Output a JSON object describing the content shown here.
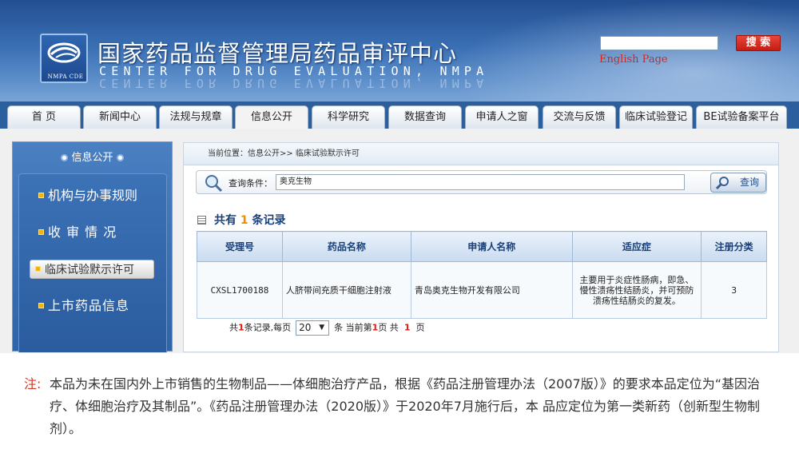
{
  "header": {
    "logo_caption": "NMPA CDE",
    "title": "国家药品监督管理局药品审评中心",
    "subtitle": "CENTER FOR DRUG EVALUATION, NMPA",
    "search_button": "搜 索",
    "english_link": "English Page"
  },
  "nav": {
    "tabs": [
      {
        "label": "首  页"
      },
      {
        "label": "新闻中心"
      },
      {
        "label": "法规与规章"
      },
      {
        "label": "信息公开"
      },
      {
        "label": "科学研究"
      },
      {
        "label": "数据查询"
      },
      {
        "label": "申请人之窗"
      },
      {
        "label": "交流与反馈"
      },
      {
        "label": "临床试验登记"
      },
      {
        "label": "BE试验备案平台"
      }
    ],
    "active_tab": "信息公开"
  },
  "sidebar": {
    "header": "信息公开",
    "items": [
      {
        "label": "机构与办事规则"
      },
      {
        "label": "收 审 情 况"
      },
      {
        "label": "临床试验默示许可"
      },
      {
        "label": "上市药品信息"
      }
    ],
    "active_item": "临床试验默示许可"
  },
  "content": {
    "breadcrumb": "当前位置：信息公开>> 临床试验默示许可",
    "query": {
      "label": "查询条件：",
      "value": "奥克生物",
      "button": "查询"
    },
    "result_summary": {
      "prefix": "共有",
      "count": "1",
      "suffix": "条记录"
    },
    "table": {
      "columns": [
        "受理号",
        "药品名称",
        "申请人名称",
        "适应症",
        "注册分类"
      ],
      "rows": [
        {
          "id": "CXSL1700188",
          "drug": "人脐带间充质干细胞注射液",
          "applicant": "青岛奥克生物开发有限公司",
          "indication": "主要用于炎症性肠病，即急、慢性溃疡性结肠炎，并可预防溃疡性结肠炎的复发。",
          "category": "3"
        }
      ]
    },
    "pager": {
      "t1": "共",
      "total": "1",
      "t2": "条记录,每页",
      "per_page": "20",
      "t3": "条 当前第",
      "current": "1",
      "t4": "页 共",
      "pages": "1",
      "t5": "页"
    }
  },
  "note": {
    "label": "注:",
    "text": "本品为未在国内外上市销售的生物制品——体细胞治疗产品，根据《药品注册管理办法（2007版）》的要求本品定位为“基因治疗、体细胞治疗及其制品”。《药品注册管理办法（2020版）》于2020年7月施行后，本 品应定位为第一类新药（创新型生物制剂）。"
  },
  "colors": {
    "header_blue": "#2c5f9e",
    "search_red": "#d32a1e",
    "note_red": "#d03a2a",
    "count_orange": "#f08c00"
  }
}
